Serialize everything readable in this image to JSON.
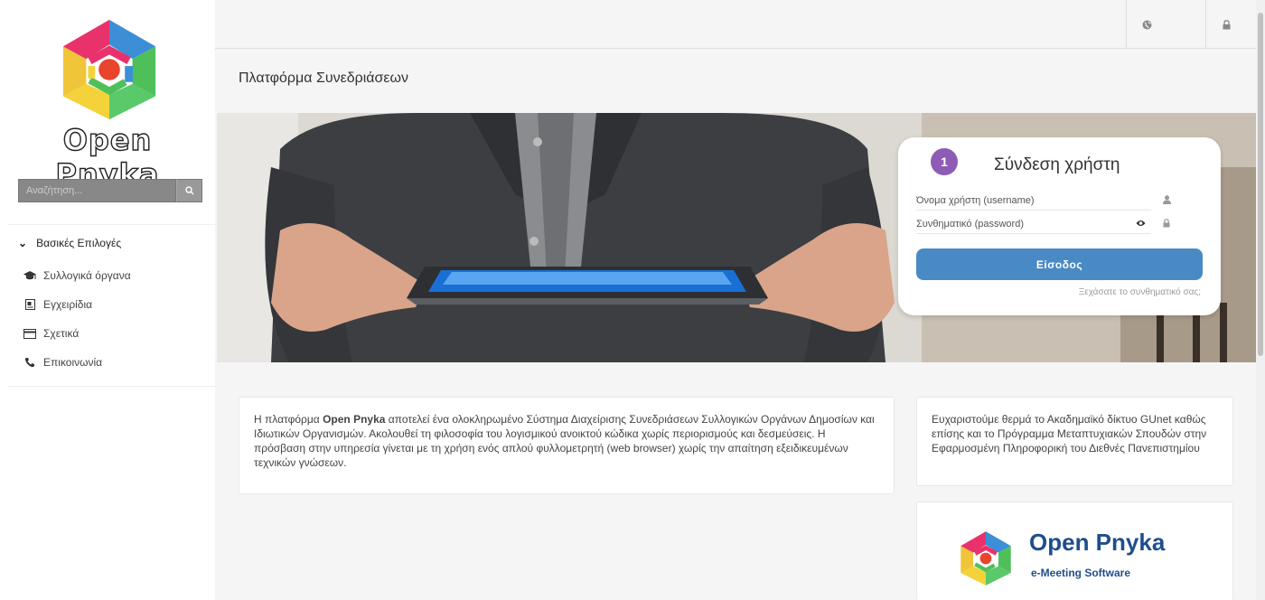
{
  "sidebar": {
    "brand": "Open Pnyka",
    "search_placeholder": "Αναζήτηση...",
    "menu_title": "Βασικές Επιλογές",
    "items": [
      {
        "label": "Συλλογικά όργανα",
        "icon": "graduation-cap-icon"
      },
      {
        "label": "Εγχειρίδια",
        "icon": "document-icon"
      },
      {
        "label": "Σχετικά",
        "icon": "card-icon"
      },
      {
        "label": "Επικοινωνία",
        "icon": "phone-icon"
      }
    ]
  },
  "topbar": {
    "buttons": [
      {
        "icon": "globe-icon"
      },
      {
        "icon": "lock-icon"
      }
    ]
  },
  "page": {
    "title": "Πλατφόρμα Συνεδριάσεων"
  },
  "login": {
    "step": "1",
    "title": "Σύνδεση χρήστη",
    "username_placeholder": "Όνομα χρήστη (username)",
    "password_placeholder": "Συνθηματικό (password)",
    "submit_label": "Είσοδος",
    "forgot_label": "Ξεχάσατε το συνθηματικό σας;"
  },
  "about": {
    "text_before": "Η πλατφόρμα ",
    "brand": "Open Pnyka",
    "text_after": " αποτελεί ένα ολοκληρωμένο Σύστημα Διαχείρισης Συνεδριάσεων Συλλογικών Οργάνων Δημοσίων και Ιδιωτικών Οργανισμών. Ακολουθεί τη φιλοσοφία του λογισμικού ανοικτού κώδικα χωρίς περιορισμούς και δεσμεύσεις. Η πρόσβαση στην υπηρεσία γίνεται με τη χρήση ενός απλού φυλλομετρητή (web browser) χωρίς την απαίτηση εξειδικευμένων τεχνικών γνώσεων."
  },
  "thanks": {
    "text": "Ευχαριστούμε θερμά το Ακαδημαϊκό δίκτυο GUnet καθώς επίσης και το Πρόγραμμα Μεταπτυχιακών Σπουδών στην Εφαρμοσμένη Πληροφορική του Διεθνές Πανεπιστημίου"
  },
  "brand_card": {
    "name": "Open Pnyka",
    "subtitle": "e-Meeting Software"
  },
  "colors": {
    "accent": "#4a8ac4",
    "badge": "#8e5bb5",
    "brand_blue": "#1f4e8c"
  }
}
